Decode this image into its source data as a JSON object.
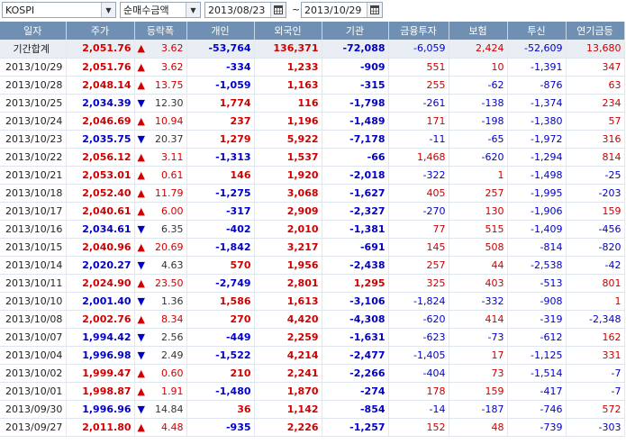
{
  "toolbar": {
    "market": "KOSPI",
    "mode": "순매수금액",
    "start_date": "2013/08/23",
    "separator": "~",
    "end_date": "2013/10/29"
  },
  "columns": [
    "일자",
    "주가",
    "등락폭",
    "개인",
    "외국인",
    "기관",
    "금융투자",
    "보험",
    "투신",
    "연기금등"
  ],
  "rows": [
    {
      "date": "기간합계",
      "price": "2,051.76",
      "dir": "up",
      "change": "3.62",
      "indiv": "-53,764",
      "foreign": "136,371",
      "inst": "-72,088",
      "fin": "-6,059",
      "ins": "2,424",
      "trust": "-52,609",
      "pension": "13,680"
    },
    {
      "date": "2013/10/29",
      "price": "2,051.76",
      "dir": "up",
      "change": "3.62",
      "indiv": "-334",
      "foreign": "1,233",
      "inst": "-909",
      "fin": "551",
      "ins": "10",
      "trust": "-1,391",
      "pension": "347"
    },
    {
      "date": "2013/10/28",
      "price": "2,048.14",
      "dir": "up",
      "change": "13.75",
      "indiv": "-1,059",
      "foreign": "1,163",
      "inst": "-315",
      "fin": "255",
      "ins": "-62",
      "trust": "-876",
      "pension": "63"
    },
    {
      "date": "2013/10/25",
      "price": "2,034.39",
      "dir": "down",
      "change": "12.30",
      "indiv": "1,774",
      "foreign": "116",
      "inst": "-1,798",
      "fin": "-261",
      "ins": "-138",
      "trust": "-1,374",
      "pension": "234"
    },
    {
      "date": "2013/10/24",
      "price": "2,046.69",
      "dir": "up",
      "change": "10.94",
      "indiv": "237",
      "foreign": "1,196",
      "inst": "-1,489",
      "fin": "171",
      "ins": "-198",
      "trust": "-1,380",
      "pension": "57"
    },
    {
      "date": "2013/10/23",
      "price": "2,035.75",
      "dir": "down",
      "change": "20.37",
      "indiv": "1,279",
      "foreign": "5,922",
      "inst": "-7,178",
      "fin": "-11",
      "ins": "-65",
      "trust": "-1,972",
      "pension": "316"
    },
    {
      "date": "2013/10/22",
      "price": "2,056.12",
      "dir": "up",
      "change": "3.11",
      "indiv": "-1,313",
      "foreign": "1,537",
      "inst": "-66",
      "fin": "1,468",
      "ins": "-620",
      "trust": "-1,294",
      "pension": "814"
    },
    {
      "date": "2013/10/21",
      "price": "2,053.01",
      "dir": "up",
      "change": "0.61",
      "indiv": "146",
      "foreign": "1,920",
      "inst": "-2,018",
      "fin": "-322",
      "ins": "1",
      "trust": "-1,498",
      "pension": "-25"
    },
    {
      "date": "2013/10/18",
      "price": "2,052.40",
      "dir": "up",
      "change": "11.79",
      "indiv": "-1,275",
      "foreign": "3,068",
      "inst": "-1,627",
      "fin": "405",
      "ins": "257",
      "trust": "-1,995",
      "pension": "-203"
    },
    {
      "date": "2013/10/17",
      "price": "2,040.61",
      "dir": "up",
      "change": "6.00",
      "indiv": "-317",
      "foreign": "2,909",
      "inst": "-2,327",
      "fin": "-270",
      "ins": "130",
      "trust": "-1,906",
      "pension": "159"
    },
    {
      "date": "2013/10/16",
      "price": "2,034.61",
      "dir": "down",
      "change": "6.35",
      "indiv": "-402",
      "foreign": "2,010",
      "inst": "-1,381",
      "fin": "77",
      "ins": "515",
      "trust": "-1,409",
      "pension": "-456"
    },
    {
      "date": "2013/10/15",
      "price": "2,040.96",
      "dir": "up",
      "change": "20.69",
      "indiv": "-1,842",
      "foreign": "3,217",
      "inst": "-691",
      "fin": "145",
      "ins": "508",
      "trust": "-814",
      "pension": "-820"
    },
    {
      "date": "2013/10/14",
      "price": "2,020.27",
      "dir": "down",
      "change": "4.63",
      "indiv": "570",
      "foreign": "1,956",
      "inst": "-2,438",
      "fin": "257",
      "ins": "44",
      "trust": "-2,538",
      "pension": "-42"
    },
    {
      "date": "2013/10/11",
      "price": "2,024.90",
      "dir": "up",
      "change": "23.50",
      "indiv": "-2,749",
      "foreign": "2,801",
      "inst": "1,295",
      "fin": "325",
      "ins": "403",
      "trust": "-513",
      "pension": "801"
    },
    {
      "date": "2013/10/10",
      "price": "2,001.40",
      "dir": "down",
      "change": "1.36",
      "indiv": "1,586",
      "foreign": "1,613",
      "inst": "-3,106",
      "fin": "-1,824",
      "ins": "-332",
      "trust": "-908",
      "pension": "1"
    },
    {
      "date": "2013/10/08",
      "price": "2,002.76",
      "dir": "up",
      "change": "8.34",
      "indiv": "270",
      "foreign": "4,420",
      "inst": "-4,308",
      "fin": "-620",
      "ins": "414",
      "trust": "-319",
      "pension": "-2,348"
    },
    {
      "date": "2013/10/07",
      "price": "1,994.42",
      "dir": "down",
      "change": "2.56",
      "indiv": "-449",
      "foreign": "2,259",
      "inst": "-1,631",
      "fin": "-623",
      "ins": "-73",
      "trust": "-612",
      "pension": "162"
    },
    {
      "date": "2013/10/04",
      "price": "1,996.98",
      "dir": "down",
      "change": "2.49",
      "indiv": "-1,522",
      "foreign": "4,214",
      "inst": "-2,477",
      "fin": "-1,405",
      "ins": "17",
      "trust": "-1,125",
      "pension": "331"
    },
    {
      "date": "2013/10/02",
      "price": "1,999.47",
      "dir": "up",
      "change": "0.60",
      "indiv": "210",
      "foreign": "2,241",
      "inst": "-2,266",
      "fin": "-404",
      "ins": "73",
      "trust": "-1,514",
      "pension": "-7"
    },
    {
      "date": "2013/10/01",
      "price": "1,998.87",
      "dir": "up",
      "change": "1.91",
      "indiv": "-1,480",
      "foreign": "1,870",
      "inst": "-274",
      "fin": "178",
      "ins": "159",
      "trust": "-417",
      "pension": "-7"
    },
    {
      "date": "2013/09/30",
      "price": "1,996.96",
      "dir": "down",
      "change": "14.84",
      "indiv": "36",
      "foreign": "1,142",
      "inst": "-854",
      "fin": "-14",
      "ins": "-187",
      "trust": "-746",
      "pension": "572"
    },
    {
      "date": "2013/09/27",
      "price": "2,011.80",
      "dir": "up",
      "change": "4.48",
      "indiv": "-935",
      "foreign": "2,226",
      "inst": "-1,257",
      "fin": "152",
      "ins": "48",
      "trust": "-739",
      "pension": "-303"
    }
  ]
}
